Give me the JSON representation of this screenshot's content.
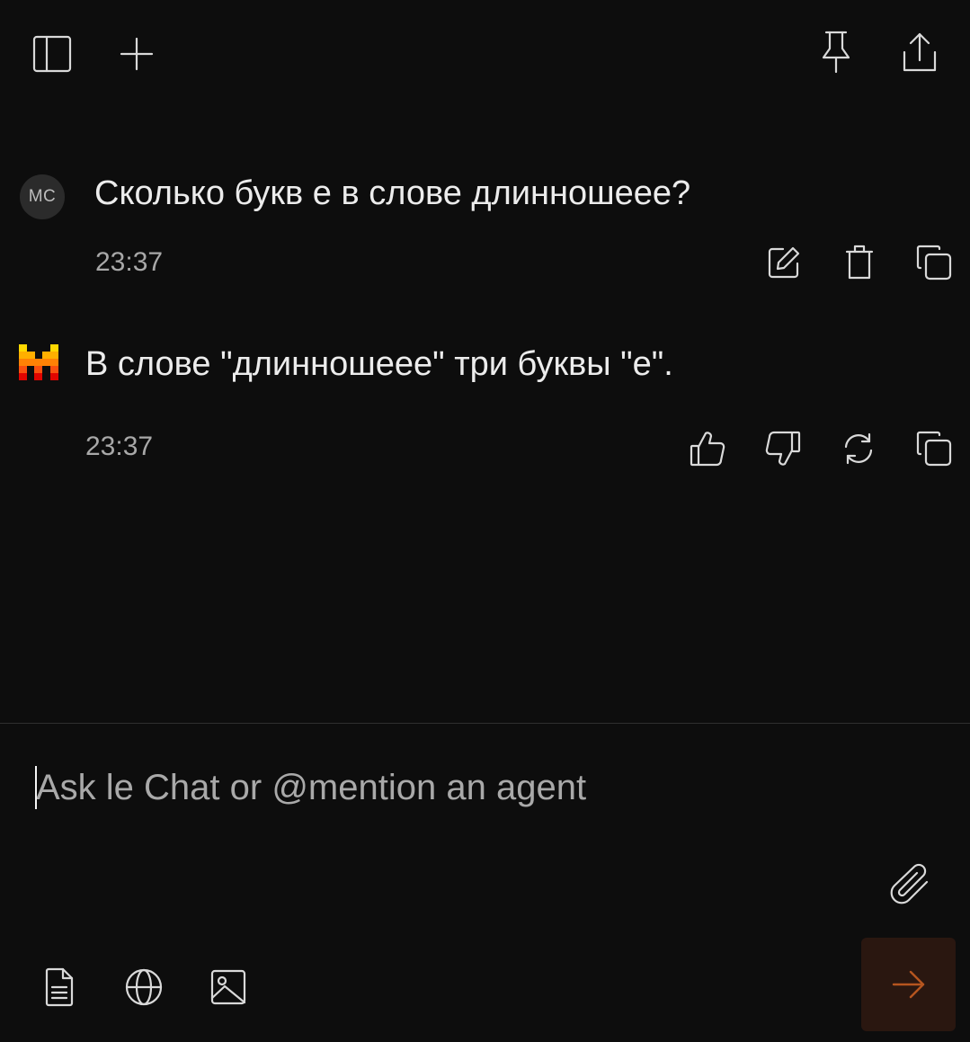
{
  "header": {
    "icons": [
      "sidebar-toggle-icon",
      "plus-icon",
      "pin-icon",
      "share-icon"
    ]
  },
  "messages": [
    {
      "role": "user",
      "avatar_initials": "MC",
      "text": "Сколько букв е в слове длинношеее?",
      "time": "23:37",
      "actions": [
        "edit-icon",
        "trash-icon",
        "copy-icon"
      ]
    },
    {
      "role": "assistant",
      "avatar": "mistral-logo",
      "text": "В слове \"длинношеее\" три буквы \"е\".",
      "time": "23:37",
      "actions": [
        "thumbs-up-icon",
        "thumbs-down-icon",
        "regenerate-icon",
        "copy-icon"
      ]
    }
  ],
  "composer": {
    "placeholder": "Ask le Chat or @mention an agent",
    "value": "",
    "tools": [
      "document-icon",
      "globe-icon",
      "image-icon",
      "paperclip-icon"
    ],
    "send_icon": "arrow-right-icon"
  },
  "colors": {
    "background": "#0d0d0d",
    "send_button_bg": "#2a1710",
    "send_arrow": "#b5551f",
    "mistral_orange": "#ff7000",
    "mistral_yellow": "#ffd800",
    "mistral_red": "#e10500"
  }
}
